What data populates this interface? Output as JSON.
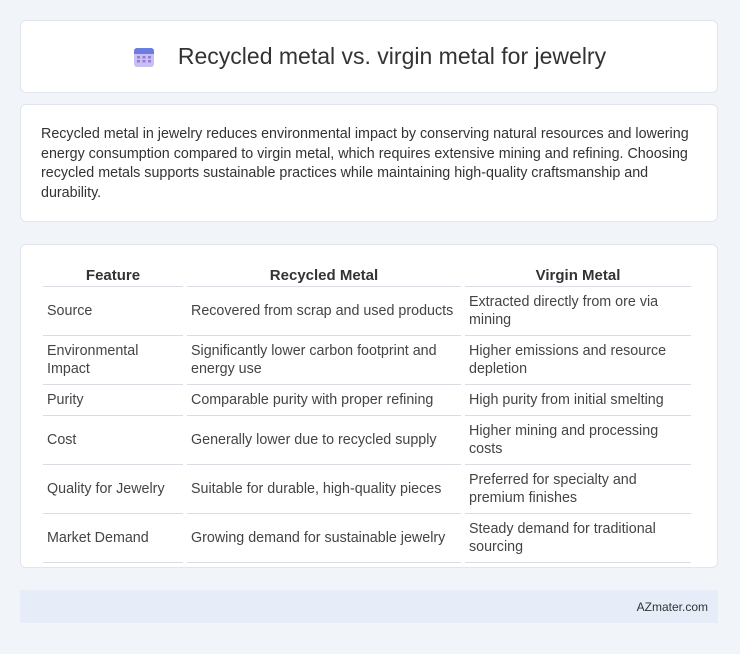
{
  "header": {
    "title": "Recycled metal vs. virgin metal for jewelry",
    "icon": "calendar-icon"
  },
  "summary": {
    "text": "Recycled metal in jewelry reduces environmental impact by conserving natural resources and lowering energy consumption compared to virgin metal, which requires extensive mining and refining. Choosing recycled metals supports sustainable practices while maintaining high-quality craftsmanship and durability."
  },
  "table": {
    "headers": [
      "Feature",
      "Recycled Metal",
      "Virgin Metal"
    ],
    "rows": [
      [
        "Source",
        "Recovered from scrap and used products",
        "Extracted directly from ore via mining"
      ],
      [
        "Environmental Impact",
        "Significantly lower carbon footprint and energy use",
        "Higher emissions and resource depletion"
      ],
      [
        "Purity",
        "Comparable purity with proper refining",
        "High purity from initial smelting"
      ],
      [
        "Cost",
        "Generally lower due to recycled supply",
        "Higher mining and processing costs"
      ],
      [
        "Quality for Jewelry",
        "Suitable for durable, high-quality pieces",
        "Preferred for specialty and premium finishes"
      ],
      [
        "Market Demand",
        "Growing demand for sustainable jewelry",
        "Steady demand for traditional sourcing"
      ]
    ]
  },
  "footer": {
    "brand": "AZmater.com"
  },
  "colors": {
    "background": "#f1f4f9",
    "footer_bg": "#e6ecf8",
    "icon_top": "#6b7de0",
    "icon_body": "#b7a6ea"
  }
}
